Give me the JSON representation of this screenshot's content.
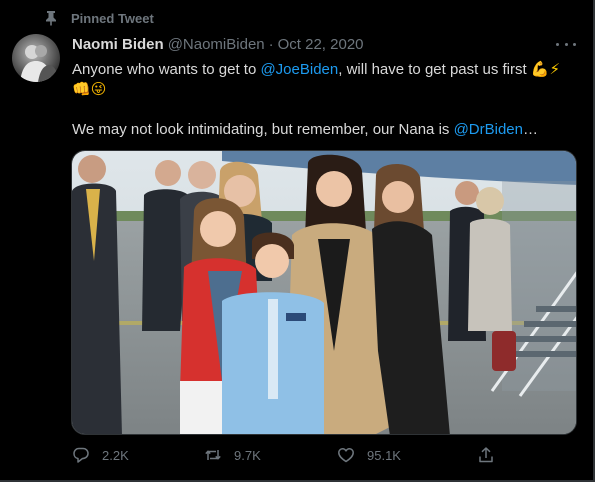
{
  "pinned": {
    "label": "Pinned Tweet",
    "icon": "pin-icon"
  },
  "author": {
    "display_name": "Naomi Biden",
    "handle": "@NaomiBiden",
    "separator": "·",
    "date": "Oct 22, 2020"
  },
  "tweet": {
    "line1_pre": "Anyone who wants to get to ",
    "line1_mention": "@JoeBiden",
    "line1_post": ", will have to get past us first",
    "line3_pre": "We may not look intimidating, but remember, our Nana is ",
    "line3_mention": "@DrBiden",
    "line3_post": "…",
    "emojis": [
      "flexed-biceps",
      "lightning-bolt",
      "oncoming-fist",
      "winking-face-with-tongue"
    ]
  },
  "actions": {
    "reply_count": "2.2K",
    "retweet_count": "9.7K",
    "like_count": "95.1K"
  },
  "colors": {
    "background": "#000000",
    "text": "#d9d9d9",
    "muted": "#6e767d",
    "link": "#1d9bf0",
    "border": "#2f3336"
  }
}
